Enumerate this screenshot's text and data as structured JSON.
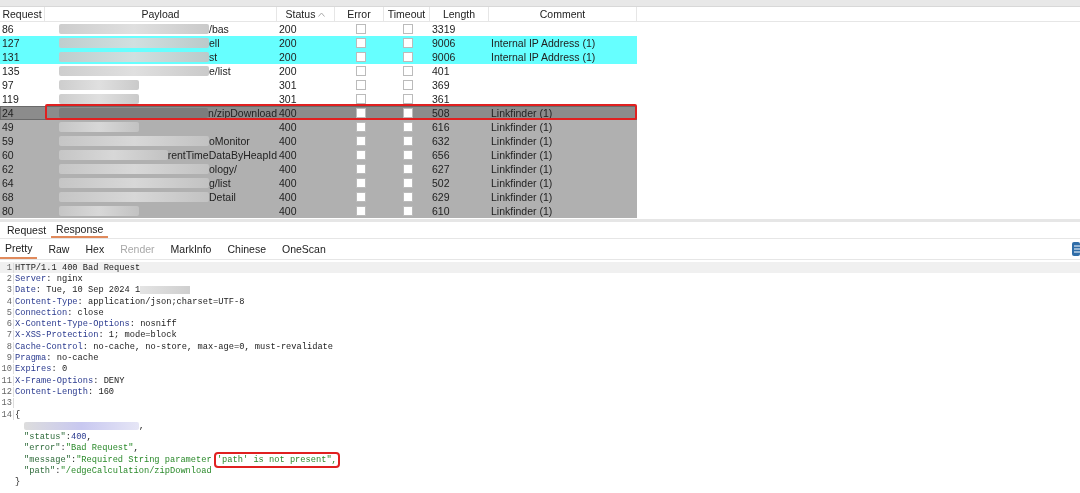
{
  "table": {
    "columns": [
      {
        "label": "Request",
        "sorted": false
      },
      {
        "label": "Payload",
        "sorted": false
      },
      {
        "label": "Status",
        "sorted": true
      },
      {
        "label": "Error",
        "sorted": false
      },
      {
        "label": "Timeout",
        "sorted": false
      },
      {
        "label": "Length",
        "sorted": false
      },
      {
        "label": "Comment",
        "sorted": false
      }
    ],
    "rows": [
      {
        "request": "86",
        "payload": "/bas",
        "redacted": true,
        "status": "200",
        "error": false,
        "timeout": false,
        "length": "3319",
        "comment": "",
        "color": "#ffffff",
        "selected": false,
        "annotated": false
      },
      {
        "request": "127",
        "payload": "ell",
        "redacted": true,
        "status": "200",
        "error": false,
        "timeout": false,
        "length": "9006",
        "comment": "Internal IP Address (1)",
        "color": "#66ffff",
        "selected": false,
        "annotated": false
      },
      {
        "request": "131",
        "payload": "st",
        "redacted": true,
        "status": "200",
        "error": false,
        "timeout": false,
        "length": "9006",
        "comment": "Internal IP Address (1)",
        "color": "#66ffff",
        "selected": false,
        "annotated": false
      },
      {
        "request": "135",
        "payload": "e/list",
        "redacted": true,
        "status": "200",
        "error": false,
        "timeout": false,
        "length": "401",
        "comment": "",
        "color": "#ffffff",
        "selected": false,
        "annotated": false
      },
      {
        "request": "97",
        "payload": "",
        "redacted": true,
        "status": "301",
        "error": false,
        "timeout": false,
        "length": "369",
        "comment": "",
        "color": "#ffffff",
        "selected": false,
        "annotated": false
      },
      {
        "request": "119",
        "payload": "",
        "redacted": true,
        "status": "301",
        "error": false,
        "timeout": false,
        "length": "361",
        "comment": "",
        "color": "#ffffff",
        "selected": false,
        "annotated": false
      },
      {
        "request": "24",
        "payload": "n/zipDownload",
        "redacted": true,
        "status": "400",
        "error": false,
        "timeout": false,
        "length": "508",
        "comment": "Linkfinder (1)",
        "color": "#8c8c8c",
        "selected": true,
        "annotated": true
      },
      {
        "request": "49",
        "payload": "",
        "redacted": true,
        "status": "400",
        "error": false,
        "timeout": false,
        "length": "616",
        "comment": "Linkfinder (1)",
        "color": "#b0b0b0",
        "selected": false,
        "annotated": false
      },
      {
        "request": "59",
        "payload": "oMonitor",
        "redacted": true,
        "status": "400",
        "error": false,
        "timeout": false,
        "length": "632",
        "comment": "Linkfinder (1)",
        "color": "#b0b0b0",
        "selected": false,
        "annotated": false
      },
      {
        "request": "60",
        "payload": "rentTimeDataByHeapId",
        "redacted": true,
        "status": "400",
        "error": false,
        "timeout": false,
        "length": "656",
        "comment": "Linkfinder (1)",
        "color": "#b0b0b0",
        "selected": false,
        "annotated": false
      },
      {
        "request": "62",
        "payload": "ology/",
        "redacted": true,
        "status": "400",
        "error": false,
        "timeout": false,
        "length": "627",
        "comment": "Linkfinder (1)",
        "color": "#b0b0b0",
        "selected": false,
        "annotated": false
      },
      {
        "request": "64",
        "payload": "g/list",
        "redacted": true,
        "status": "400",
        "error": false,
        "timeout": false,
        "length": "502",
        "comment": "Linkfinder (1)",
        "color": "#b0b0b0",
        "selected": false,
        "annotated": false
      },
      {
        "request": "68",
        "payload": "Detail",
        "redacted": true,
        "status": "400",
        "error": false,
        "timeout": false,
        "length": "629",
        "comment": "Linkfinder (1)",
        "color": "#b0b0b0",
        "selected": false,
        "annotated": false
      },
      {
        "request": "80",
        "payload": "",
        "redacted": true,
        "status": "400",
        "error": false,
        "timeout": false,
        "length": "610",
        "comment": "Linkfinder (1)",
        "color": "#b0b0b0",
        "selected": false,
        "annotated": false
      }
    ]
  },
  "message_tabs": [
    {
      "label": "Request",
      "selected": false
    },
    {
      "label": "Response",
      "selected": true
    }
  ],
  "view_tabs": [
    {
      "label": "Pretty",
      "selected": true,
      "disabled": false
    },
    {
      "label": "Raw",
      "selected": false,
      "disabled": false
    },
    {
      "label": "Hex",
      "selected": false,
      "disabled": false
    },
    {
      "label": "Render",
      "selected": false,
      "disabled": true
    },
    {
      "label": "MarkInfo",
      "selected": false,
      "disabled": false
    },
    {
      "label": "Chinese",
      "selected": false,
      "disabled": false
    },
    {
      "label": "OneScan",
      "selected": false,
      "disabled": false
    }
  ],
  "editor": {
    "lines": [
      {
        "number": "1",
        "redacted": false,
        "highlighted": true,
        "segments": [
          {
            "kind": "plain",
            "text": "HTTP/1.1 400 Bad Request"
          }
        ]
      },
      {
        "number": "2",
        "redacted": false,
        "highlighted": false,
        "segments": [
          {
            "kind": "header",
            "text": "Server"
          },
          {
            "kind": "plain",
            "text": ": nginx"
          }
        ]
      },
      {
        "number": "3",
        "redacted": true,
        "highlighted": false,
        "segments": [
          {
            "kind": "header",
            "text": "Date"
          },
          {
            "kind": "plain",
            "text": ": Tue, 10 Sep 2024 1"
          }
        ]
      },
      {
        "number": "4",
        "redacted": false,
        "highlighted": false,
        "segments": [
          {
            "kind": "header",
            "text": "Content-Type"
          },
          {
            "kind": "plain",
            "text": ": application/json;charset=UTF-8"
          }
        ]
      },
      {
        "number": "5",
        "redacted": false,
        "highlighted": false,
        "segments": [
          {
            "kind": "header",
            "text": "Connection"
          },
          {
            "kind": "plain",
            "text": ": close"
          }
        ]
      },
      {
        "number": "6",
        "redacted": false,
        "highlighted": false,
        "segments": [
          {
            "kind": "header",
            "text": "X-Content-Type-Options"
          },
          {
            "kind": "plain",
            "text": ": nosniff"
          }
        ]
      },
      {
        "number": "7",
        "redacted": false,
        "highlighted": false,
        "segments": [
          {
            "kind": "header",
            "text": "X-XSS-Protection"
          },
          {
            "kind": "plain",
            "text": ": 1; mode=block"
          }
        ]
      },
      {
        "number": "8",
        "redacted": false,
        "highlighted": false,
        "segments": [
          {
            "kind": "header",
            "text": "Cache-Control"
          },
          {
            "kind": "plain",
            "text": ": no-cache, no-store, max-age=0, must-revalidate"
          }
        ]
      },
      {
        "number": "9",
        "redacted": false,
        "highlighted": false,
        "segments": [
          {
            "kind": "header",
            "text": "Pragma"
          },
          {
            "kind": "plain",
            "text": ": no-cache"
          }
        ]
      },
      {
        "number": "10",
        "redacted": false,
        "highlighted": false,
        "segments": [
          {
            "kind": "header",
            "text": "Expires"
          },
          {
            "kind": "plain",
            "text": ": 0"
          }
        ]
      },
      {
        "number": "11",
        "redacted": false,
        "highlighted": false,
        "segments": [
          {
            "kind": "header",
            "text": "X-Frame-Options"
          },
          {
            "kind": "plain",
            "text": ": DENY"
          }
        ]
      },
      {
        "number": "12",
        "redacted": false,
        "highlighted": false,
        "segments": [
          {
            "kind": "header",
            "text": "Content-Length"
          },
          {
            "kind": "plain",
            "text": ": 160"
          }
        ]
      },
      {
        "number": "13",
        "redacted": false,
        "highlighted": false
      },
      {
        "number": "14",
        "redacted": false,
        "highlighted": false,
        "segments": [
          {
            "kind": "plain",
            "text": "{"
          }
        ]
      },
      {
        "redacted": true,
        "highlighted": false,
        "indent": true,
        "segments": [
          {
            "kind": "plain",
            "text": ","
          }
        ]
      },
      {
        "redacted": false,
        "highlighted": false,
        "indent": true,
        "segments": [
          {
            "kind": "key",
            "text": "\"status\""
          },
          {
            "kind": "plain",
            "text": ":"
          },
          {
            "kind": "number",
            "text": "400"
          },
          {
            "kind": "plain",
            "text": ","
          }
        ]
      },
      {
        "redacted": false,
        "highlighted": false,
        "indent": true,
        "segments": [
          {
            "kind": "key",
            "text": "\"error\""
          },
          {
            "kind": "plain",
            "text": ":"
          },
          {
            "kind": "string",
            "text": "\"Bad Request\""
          },
          {
            "kind": "plain",
            "text": ","
          }
        ]
      },
      {
        "redacted": false,
        "highlighted": false,
        "indent": true,
        "segments": [
          {
            "kind": "key",
            "text": "\"message\""
          },
          {
            "kind": "plain",
            "text": ":"
          },
          {
            "kind": "string",
            "text": "\"Required String parameter "
          },
          {
            "kind": "string",
            "text": "'path' is not present\",",
            "annotated": true
          }
        ]
      },
      {
        "redacted": false,
        "highlighted": false,
        "indent": true,
        "segments": [
          {
            "kind": "key",
            "text": "\"path\""
          },
          {
            "kind": "plain",
            "text": ":"
          },
          {
            "kind": "string",
            "text": "\"/edgeCalculation/zipDownload"
          }
        ]
      },
      {
        "redacted": false,
        "highlighted": false,
        "segments": [
          {
            "kind": "plain",
            "text": "}"
          }
        ]
      }
    ]
  }
}
